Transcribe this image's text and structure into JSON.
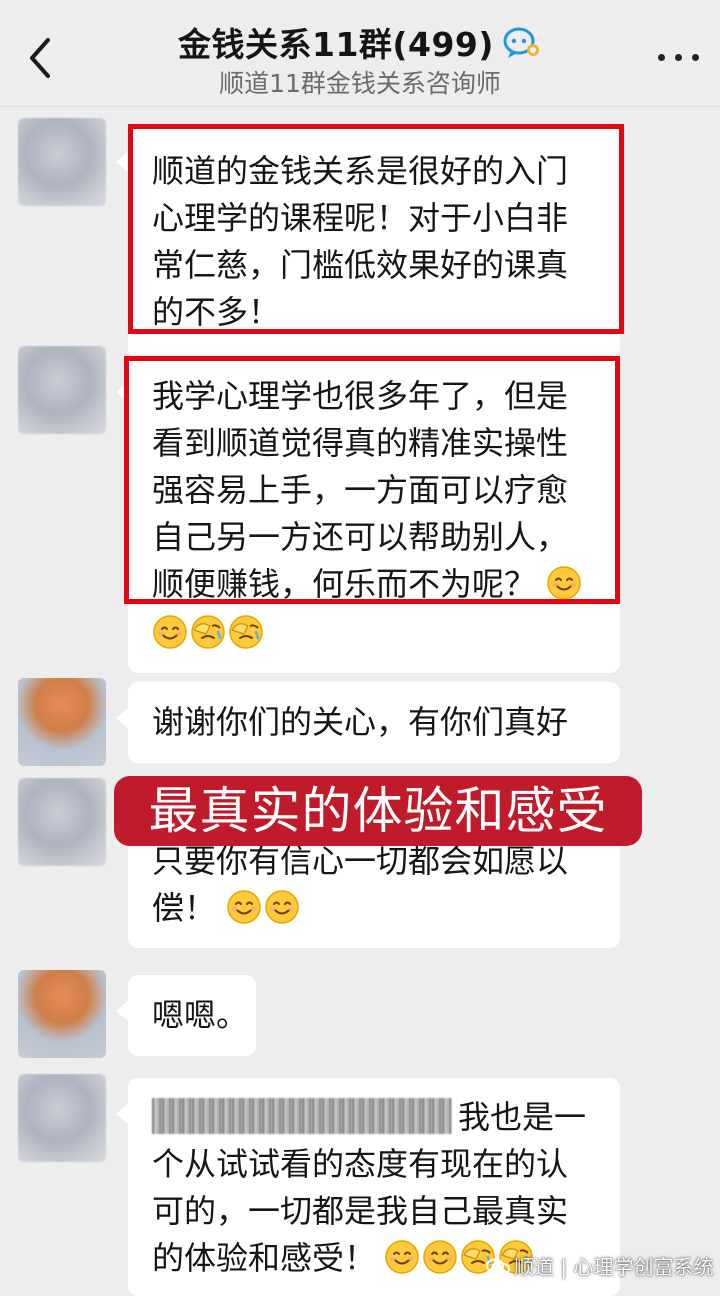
{
  "header": {
    "title": "金钱关系11群(499)",
    "subtitle": "顺道11群金钱关系咨询师",
    "group_icon": "group-chat-icon",
    "back_icon": "chevron-left-icon",
    "more_icon": "more-dots-icon"
  },
  "messages": [
    {
      "avatar": "blurred",
      "lines": [
        "顺道的金钱关系是很好的入门",
        "心理学的课程呢！对于小白非",
        "常仁慈，门槛低效果好的课真",
        "的不多！"
      ]
    },
    {
      "avatar": "blurred",
      "lines": [
        "我学心理学也很多年了，但是",
        "看到顺道觉得真的精准实操性",
        "强容易上手，一方面可以疗愈",
        "自己另一方还可以帮助别人，",
        "顺便赚钱，何乐而不为呢？"
      ]
    },
    {
      "avatar": "orange-blurred",
      "lines": [
        "谢谢你们的关心，有你们真好"
      ]
    },
    {
      "avatar": "blurred",
      "lines": [
        "只要你有信心一切都会如愿以",
        "偿！"
      ]
    },
    {
      "avatar": "orange-blurred",
      "lines": [
        "嗯嗯。"
      ]
    },
    {
      "avatar": "blurred",
      "lines": [
        "我也是一",
        "个从试试看的态度有现在的认",
        "可的，一切都是我自己最真实",
        "的体验和感受！"
      ]
    }
  ],
  "banner": {
    "text": "最真实的体验和感受"
  },
  "watermark": {
    "text": "顺道 | 心理学创富系统",
    "icon": "wechat-official-account-icon"
  },
  "colors": {
    "background": "#ededed",
    "bubble": "#ffffff",
    "highlight_border": "#e30613",
    "banner": "#c01b2a"
  }
}
